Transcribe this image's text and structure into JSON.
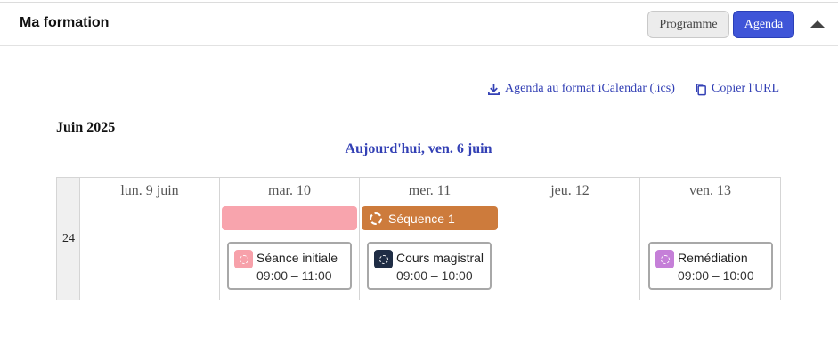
{
  "header": {
    "title": "Ma formation",
    "btn_programme": "Programme",
    "btn_agenda": "Agenda",
    "collapse_icon": "caret-up-icon"
  },
  "links": {
    "ics": "Agenda au format iCalendar (.ics)",
    "ics_icon": "download-icon",
    "copy": "Copier l'URL",
    "copy_icon": "copy-icon",
    "color": "#3340b5"
  },
  "calendar": {
    "month": "Juin 2025",
    "today": "Aujourd'hui, ven. 6 juin",
    "week_number": "24",
    "days": [
      "lun. 9 juin",
      "mar. 10",
      "mer. 11",
      "jeu. 12",
      "ven. 13"
    ],
    "sequence": {
      "label": "Séquence 1",
      "color": "#cd7b3c"
    },
    "pink_bar_color": "#f8a4ad",
    "events": [
      {
        "day": "mar. 10",
        "title": "Séance initiale",
        "time": "09:00 – 11:00",
        "icon_color": "#f7a1aa"
      },
      {
        "day": "mer. 11",
        "title": "Cours magistral",
        "time": "09:00 – 10:00",
        "icon_color": "#1f2d45"
      },
      {
        "day": "ven. 13",
        "title": "Remédiation",
        "time": "09:00 – 10:00",
        "icon_color": "#c57fd8"
      }
    ]
  }
}
